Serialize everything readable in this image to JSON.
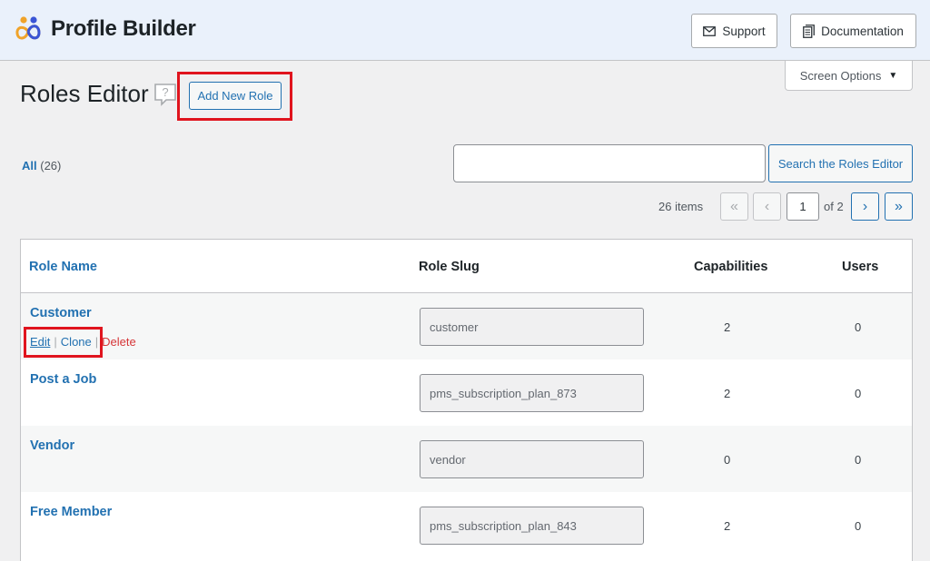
{
  "header": {
    "brand_name": "Profile Builder",
    "support_label": "Support",
    "documentation_label": "Documentation"
  },
  "screen_options": {
    "label": "Screen Options"
  },
  "page": {
    "title": "Roles Editor",
    "add_new_label": "Add New Role"
  },
  "filters": {
    "all_label": "All",
    "all_count": "(26)"
  },
  "search": {
    "value": "",
    "button_label": "Search the Roles Editor"
  },
  "pagination": {
    "items_text": "26 items",
    "first": "«",
    "prev": "‹",
    "current_page": "1",
    "of_text": "of 2",
    "next": "›",
    "last": "»"
  },
  "table": {
    "columns": {
      "name": "Role Name",
      "slug": "Role Slug",
      "capabilities": "Capabilities",
      "users": "Users"
    },
    "actions": {
      "edit": "Edit",
      "clone": "Clone",
      "delete": "Delete",
      "separator": "|"
    },
    "rows": [
      {
        "name": "Customer",
        "slug": "customer",
        "capabilities": "2",
        "users": "0"
      },
      {
        "name": "Post a Job",
        "slug": "pms_subscription_plan_873",
        "capabilities": "2",
        "users": "0"
      },
      {
        "name": "Vendor",
        "slug": "vendor",
        "capabilities": "0",
        "users": "0"
      },
      {
        "name": "Free Member",
        "slug": "pms_subscription_plan_843",
        "capabilities": "2",
        "users": "0"
      }
    ]
  },
  "colors": {
    "accent": "#2271b1",
    "highlight_red": "#e0141e",
    "delete_red": "#d63638",
    "header_bg": "#eaf1fb",
    "brand_orange": "#f0a32a",
    "brand_blue": "#3a55d6"
  },
  "icons": {
    "brand": "profile-builder-logo",
    "support": "envelope-icon",
    "documentation": "document-icon",
    "help": "help-bubble-icon",
    "dropdown": "triangle-down-icon"
  }
}
